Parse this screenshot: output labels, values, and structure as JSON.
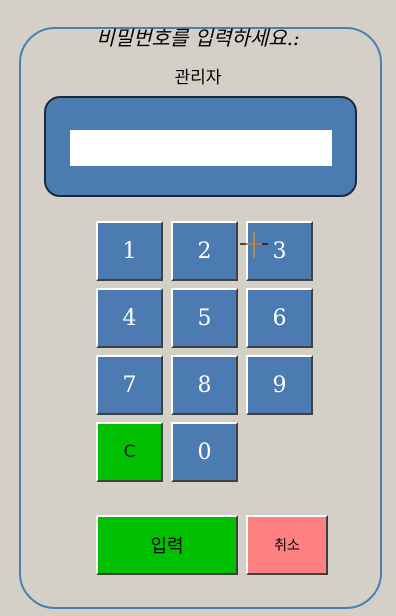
{
  "dialog": {
    "prompt": "비밀번호를 입력하세요.:",
    "user_label": "관리자"
  },
  "password": {
    "value": "",
    "placeholder": ""
  },
  "keypad": {
    "keys": [
      "1",
      "2",
      "3",
      "4",
      "5",
      "6",
      "7",
      "8",
      "9",
      "C",
      "0"
    ]
  },
  "actions": {
    "enter_label": "입력",
    "cancel_label": "취소"
  },
  "colors": {
    "panel_blue": "#4b7bb0",
    "frame_blue": "#4a7fb5",
    "clear_green": "#00c000",
    "enter_green": "#00c000",
    "cancel_red": "#ff8080",
    "background": "#d4d0c8"
  }
}
